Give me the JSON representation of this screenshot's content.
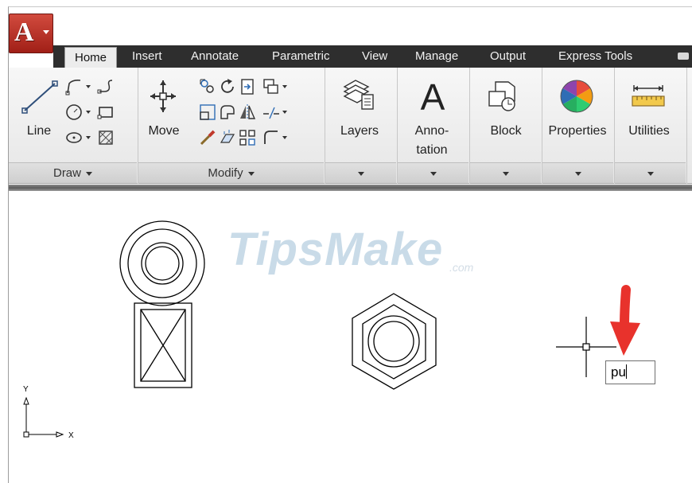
{
  "app": {
    "logo_letter": "A"
  },
  "tabs": [
    "Home",
    "Insert",
    "Annotate",
    "Parametric",
    "View",
    "Manage",
    "Output",
    "Express Tools"
  ],
  "ribbon": {
    "draw": {
      "big_label": "Line",
      "footer": "Draw"
    },
    "modify": {
      "big_label": "Move",
      "footer": "Modify"
    },
    "layers": {
      "label": "Layers"
    },
    "annotation": {
      "big_glyph": "A",
      "label_line1": "Anno-",
      "label_line2": "tation"
    },
    "block": {
      "label": "Block"
    },
    "properties": {
      "label": "Properties"
    },
    "utilities": {
      "label": "Utilities"
    }
  },
  "canvas": {
    "watermark": "TipsMake",
    "watermark_suffix": ".com",
    "ucs_y_label": "Y",
    "ucs_x_label": "X",
    "command_input": "pu"
  },
  "colors": {
    "arrow": "#e8322c",
    "tabbar": "#2e2e2e",
    "brand_red": "#c0392b"
  }
}
